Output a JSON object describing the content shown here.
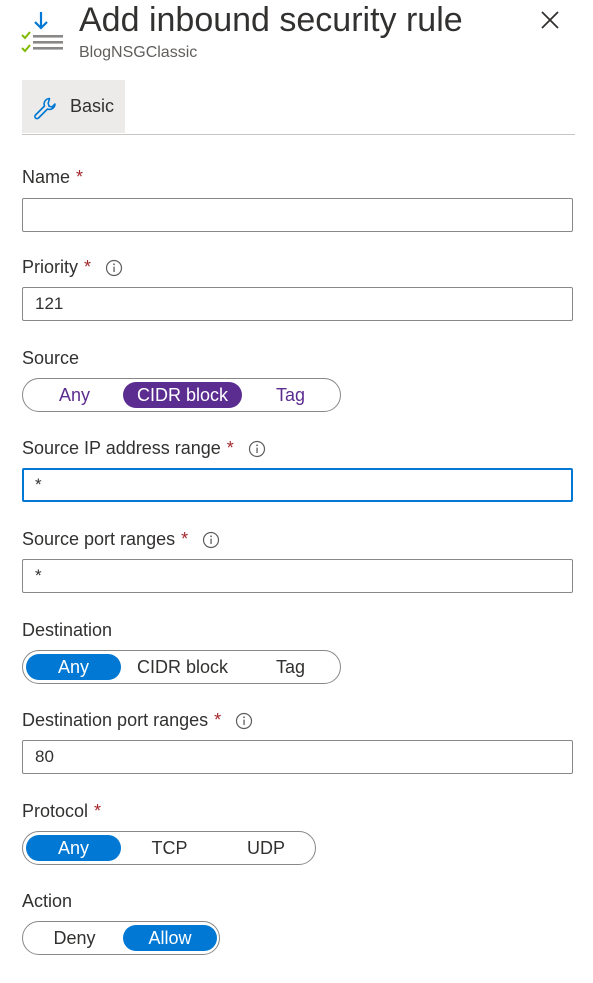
{
  "header": {
    "title": "Add inbound security rule",
    "subtitle": "BlogNSGClassic",
    "icon": "security-rule-icon",
    "close_icon": "close-icon"
  },
  "tabs": [
    {
      "label": "Basic",
      "icon": "wrench-icon",
      "selected": true
    }
  ],
  "form": {
    "name": {
      "label": "Name",
      "required": true,
      "value": ""
    },
    "priority": {
      "label": "Priority",
      "required": true,
      "info": true,
      "value": "121"
    },
    "source": {
      "label": "Source",
      "options": [
        "Any",
        "CIDR block",
        "Tag"
      ],
      "selected": "CIDR block"
    },
    "source_ip_range": {
      "label": "Source IP address range",
      "required": true,
      "info": true,
      "value": "*"
    },
    "source_port_ranges": {
      "label": "Source port ranges",
      "required": true,
      "info": true,
      "value": "*"
    },
    "destination": {
      "label": "Destination",
      "options": [
        "Any",
        "CIDR block",
        "Tag"
      ],
      "selected": "Any"
    },
    "destination_port_ranges": {
      "label": "Destination port ranges",
      "required": true,
      "info": true,
      "value": "80"
    },
    "protocol": {
      "label": "Protocol",
      "required": true,
      "options": [
        "Any",
        "TCP",
        "UDP"
      ],
      "selected": "Any"
    },
    "action": {
      "label": "Action",
      "options": [
        "Deny",
        "Allow"
      ],
      "selected": "Allow"
    }
  },
  "required_marker": "*",
  "colors": {
    "accent_blue": "#0078d4",
    "source_purple": "#5c2d91",
    "required_red": "#a4262c",
    "border_gray": "#8a8886"
  }
}
